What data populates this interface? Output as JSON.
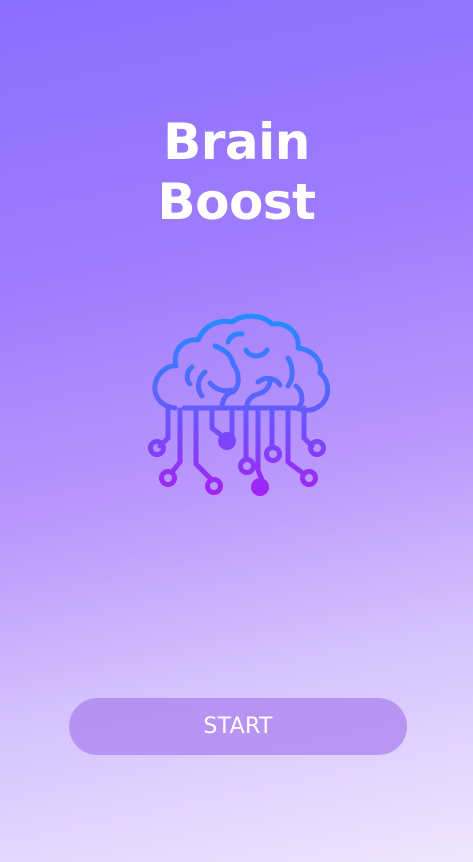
{
  "app": {
    "title_line1": "Brain",
    "title_line2": "Boost"
  },
  "icon": {
    "name": "brain-circuit-icon",
    "gradient_top": "#1f8fff",
    "gradient_bottom": "#a620f5"
  },
  "actions": {
    "start_label": "START"
  },
  "theme": {
    "background_top": "#8b6ffd",
    "background_bottom": "#efe6fe",
    "button_fill": "#b387f0",
    "text_color": "#ffffff"
  }
}
